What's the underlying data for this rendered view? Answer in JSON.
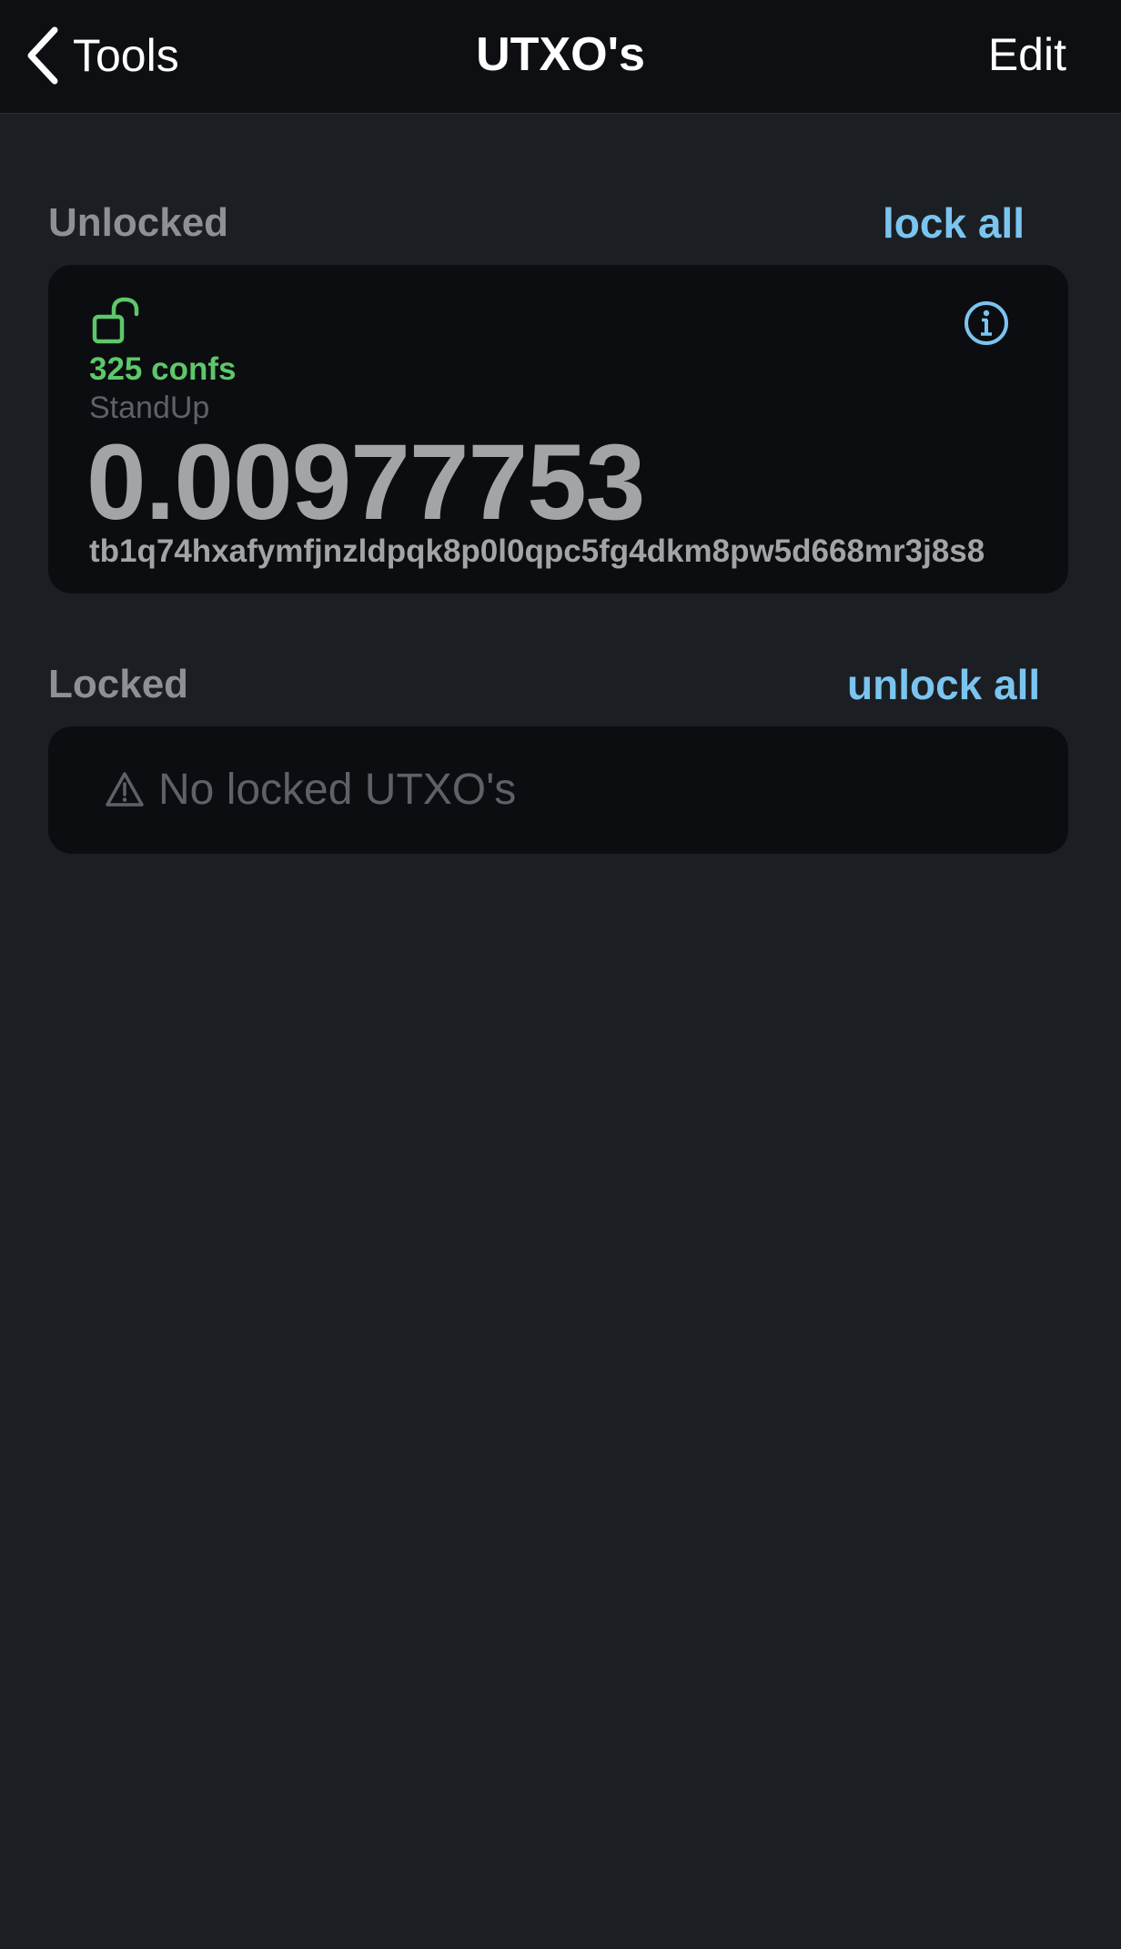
{
  "nav": {
    "back_label": "Tools",
    "title": "UTXO's",
    "edit_label": "Edit"
  },
  "unlocked": {
    "header": "Unlocked",
    "action": "lock all",
    "items": [
      {
        "confs": "325 confs",
        "label": "StandUp",
        "amount": "0.00977753",
        "address": "tb1q74hxafymfjnzldpqk8p0l0qpc5fg4dkm8pw5d668mr3j8s8"
      }
    ]
  },
  "locked": {
    "header": "Locked",
    "action": "unlock all",
    "empty_text": "No locked UTXO's"
  },
  "icons": {
    "back": "chevron-left-icon",
    "lock": "unlocked-padlock-icon",
    "info": "info-circle-icon",
    "warning": "warning-triangle-icon"
  },
  "colors": {
    "background": "#1b1f23",
    "navbar": "#0d0f13",
    "card": "#0c0d10",
    "accent": "#7cc4f0",
    "confs_green": "#5dc86a",
    "text_gray": "#a3a4a7",
    "muted": "#5e6167"
  }
}
